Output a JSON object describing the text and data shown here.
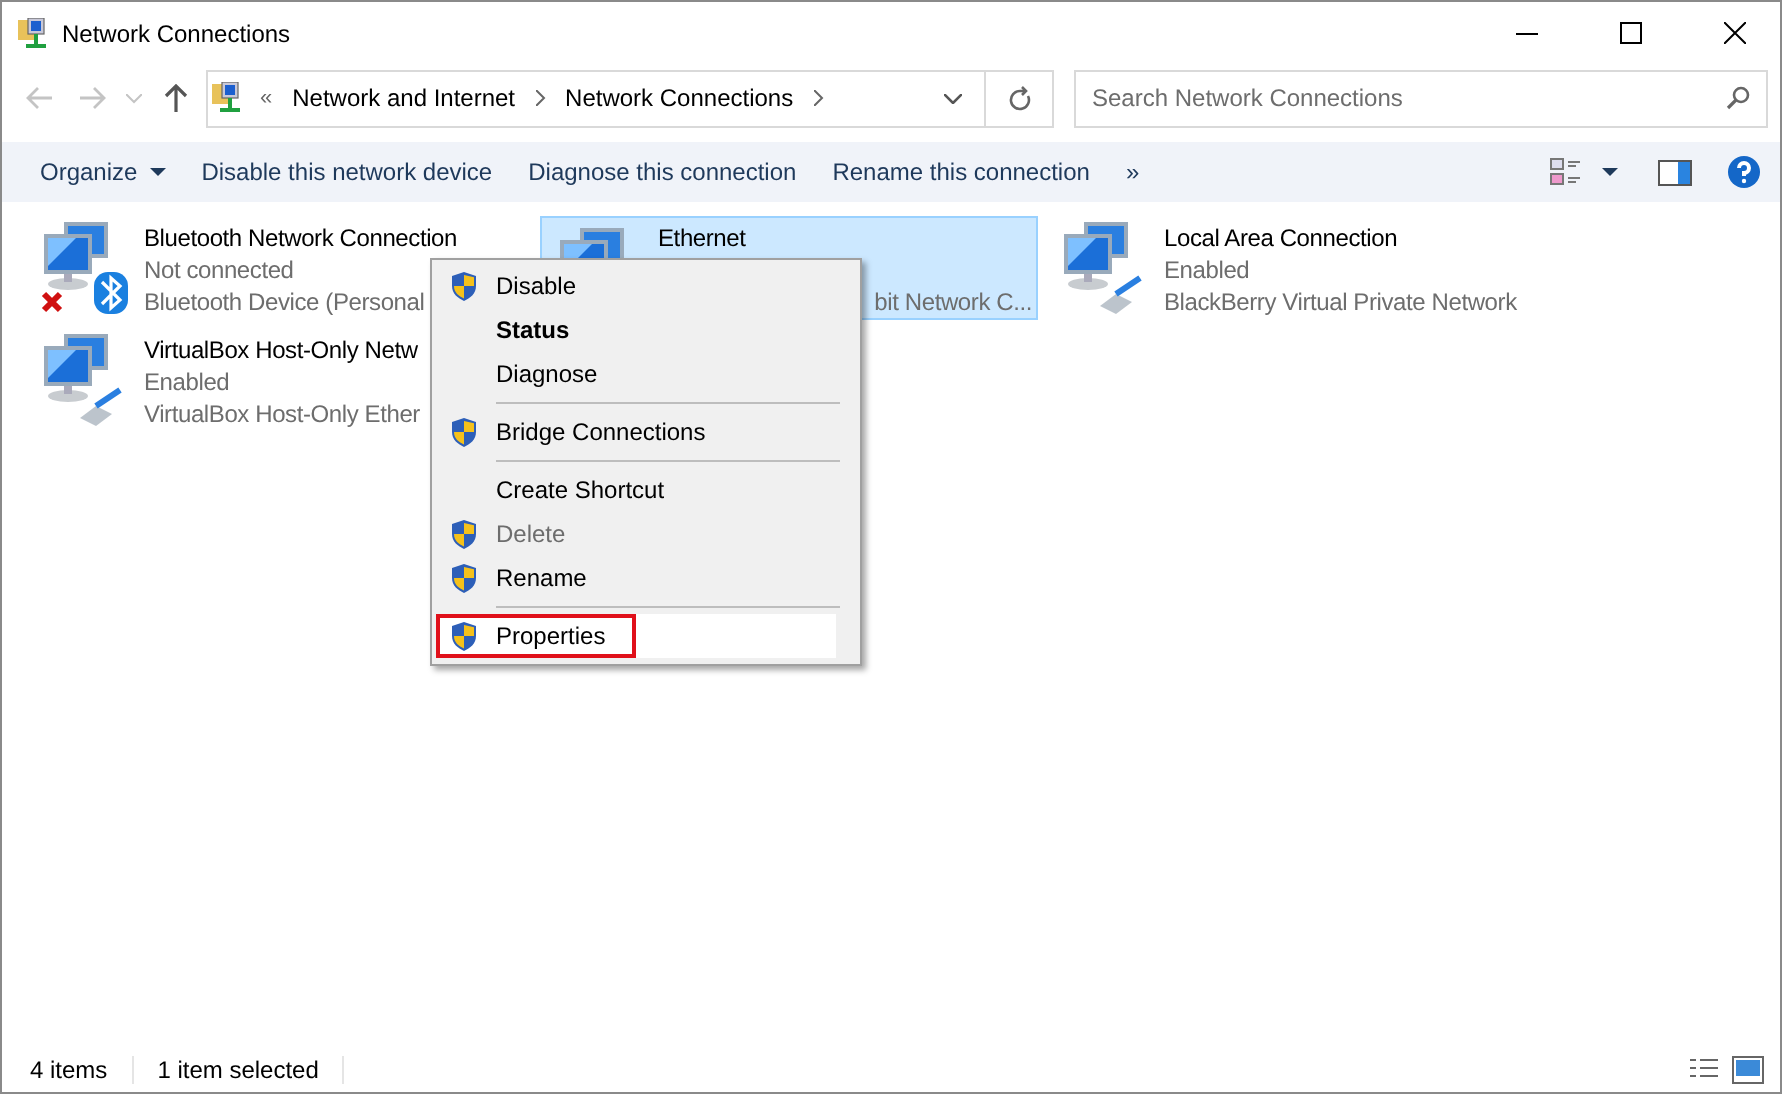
{
  "window": {
    "title": "Network Connections"
  },
  "address_bar": {
    "overflow": "«",
    "crumbs": [
      "Network and Internet",
      "Network Connections"
    ]
  },
  "search": {
    "placeholder": "Search Network Connections"
  },
  "toolbar": {
    "organize": "Organize",
    "commands": [
      "Disable this network device",
      "Diagnose this connection",
      "Rename this connection"
    ],
    "more": "»"
  },
  "connections": [
    {
      "name": "Bluetooth Network Connection",
      "status": "Not connected",
      "device": "Bluetooth Device (Personal",
      "kind": "bluetooth-off",
      "selected": false
    },
    {
      "name": "Ethernet",
      "device": "bit Network C...",
      "kind": "plain",
      "selected": true
    },
    {
      "name": "Local Area Connection",
      "status": "Enabled",
      "device": "BlackBerry Virtual Private Network",
      "kind": "cable",
      "selected": false
    },
    {
      "name": "VirtualBox Host-Only Netw",
      "status": "Enabled",
      "device": "VirtualBox Host-Only Ether",
      "kind": "cable",
      "selected": false
    }
  ],
  "context_menu": [
    {
      "kind": "item",
      "label": "Disable",
      "shield": true,
      "bold": false,
      "disabled": false,
      "selected": false
    },
    {
      "kind": "item",
      "label": "Status",
      "shield": false,
      "bold": true,
      "disabled": false,
      "selected": false
    },
    {
      "kind": "item",
      "label": "Diagnose",
      "shield": false,
      "bold": false,
      "disabled": false,
      "selected": false
    },
    {
      "kind": "separator"
    },
    {
      "kind": "item",
      "label": "Bridge Connections",
      "shield": true,
      "bold": false,
      "disabled": false,
      "selected": false
    },
    {
      "kind": "separator"
    },
    {
      "kind": "item",
      "label": "Create Shortcut",
      "shield": false,
      "bold": false,
      "disabled": false,
      "selected": false
    },
    {
      "kind": "item",
      "label": "Delete",
      "shield": true,
      "bold": false,
      "disabled": true,
      "selected": false
    },
    {
      "kind": "item",
      "label": "Rename",
      "shield": true,
      "bold": false,
      "disabled": false,
      "selected": false
    },
    {
      "kind": "separator"
    },
    {
      "kind": "item",
      "label": "Properties",
      "shield": true,
      "bold": false,
      "disabled": false,
      "selected": true
    }
  ],
  "status_bar": {
    "count": "4 items",
    "selection": "1 item selected"
  }
}
